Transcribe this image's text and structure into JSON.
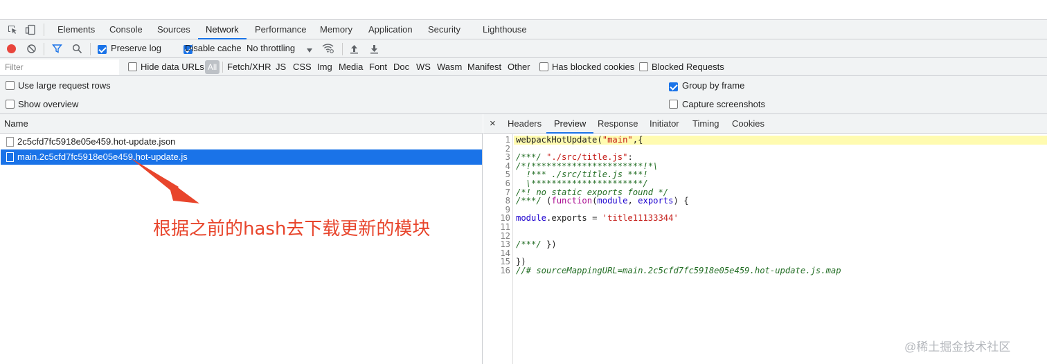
{
  "main_tabs": [
    "Elements",
    "Console",
    "Sources",
    "Network",
    "Performance",
    "Memory",
    "Application",
    "Security",
    "Lighthouse"
  ],
  "active_main_tab": "Network",
  "network_toolbar": {
    "preserve_log": "Preserve log",
    "disable_cache": "Disable cache",
    "throttling": "No throttling"
  },
  "filter_bar": {
    "placeholder": "Filter",
    "hide_data_urls": "Hide data URLs",
    "all": "All",
    "types": [
      "Fetch/XHR",
      "JS",
      "CSS",
      "Img",
      "Media",
      "Font",
      "Doc",
      "WS",
      "Wasm",
      "Manifest",
      "Other"
    ],
    "has_blocked_cookies": "Has blocked cookies",
    "blocked_requests": "Blocked Requests"
  },
  "options": {
    "large_rows": "Use large request rows",
    "show_overview": "Show overview",
    "group_by_frame": "Group by frame",
    "capture_screenshots": "Capture screenshots"
  },
  "requests": {
    "column_name": "Name",
    "rows": [
      "2c5cfd7fc5918e05e459.hot-update.json",
      "main.2c5cfd7fc5918e05e459.hot-update.js"
    ]
  },
  "annotation": "根据之前的hash去下载更新的模块",
  "detail_tabs": {
    "close": "×",
    "tabs": [
      "Headers",
      "Preview",
      "Response",
      "Initiator",
      "Timing",
      "Cookies"
    ],
    "active": "Preview"
  },
  "code": {
    "line_numbers": [
      "1",
      "2",
      "3",
      "4",
      "5",
      "6",
      "7",
      "8",
      "9",
      "10",
      "11",
      "12",
      "13",
      "14",
      "15",
      "16"
    ],
    "l1a": "webpackHotUpdate(",
    "l1b": "\"main\"",
    "l1c": ",{",
    "l3a": "/***/ ",
    "l3b": "\"./src/title.js\"",
    "l3c": ":",
    "l4": "/*!**********************!*\\",
    "l5": "  !*** ./src/title.js ***!",
    "l6": "  \\**********************/",
    "l7": "/*! no static exports found */",
    "l8a": "/***/",
    "l8b": " (",
    "l8c": "function",
    "l8d": "(",
    "l8e": "module",
    "l8f": ", ",
    "l8g": "exports",
    "l8h": ") {",
    "l10a": "module",
    "l10b": ".exports = ",
    "l10c": "'title11133344'",
    "l13a": "/***/",
    "l13b": " })",
    "l15": "})",
    "l16": "//# sourceMappingURL=main.2c5cfd7fc5918e05e459.hot-update.js.map"
  },
  "watermark": "@稀土掘金技术社区"
}
